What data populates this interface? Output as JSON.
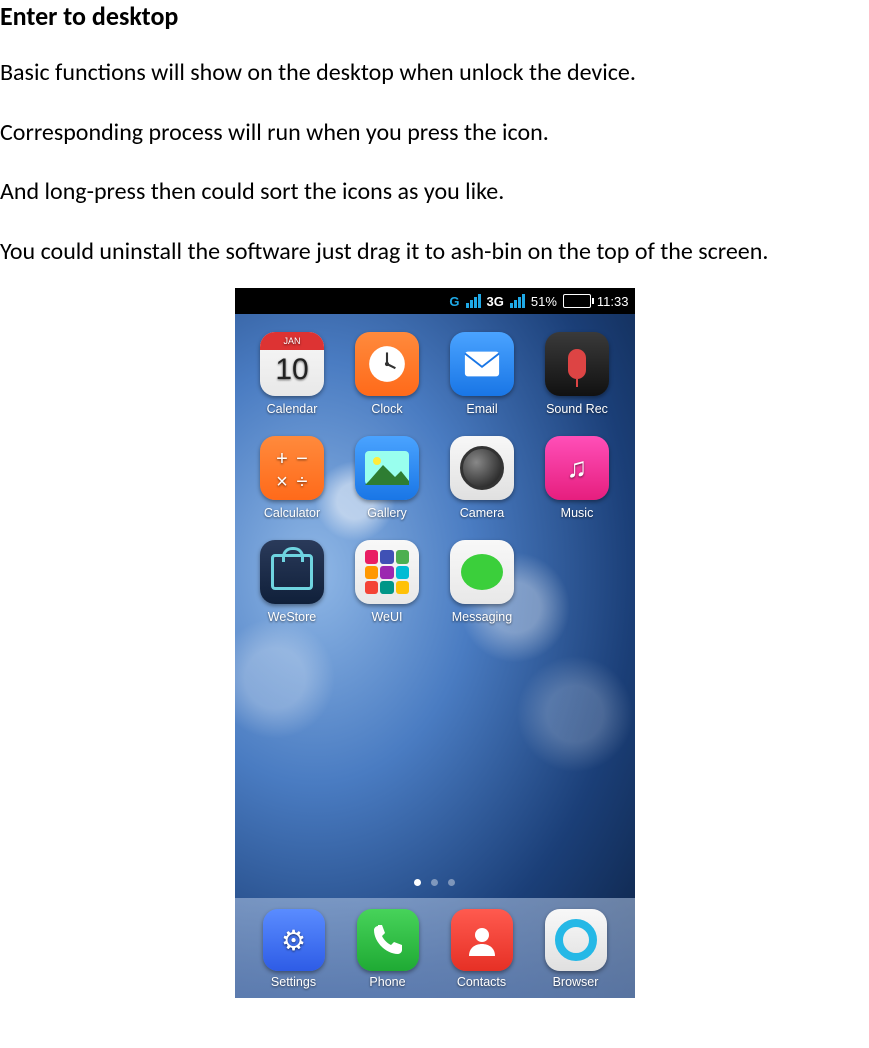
{
  "doc": {
    "heading": "Enter to desktop",
    "p1": "Basic functions will show on the desktop when unlock the device.",
    "p2": "Corresponding process will run when you press the icon.",
    "p3": "And long-press then could sort the icons as you like.",
    "p4": "You could uninstall the software just drag it to ash-bin on the top of the screen."
  },
  "status": {
    "g": "G",
    "tg": "3G",
    "battery_pct": "51%",
    "time": "11:33"
  },
  "calendar_icon": {
    "month": "JAN",
    "day": "10"
  },
  "apps": {
    "calendar": "Calendar",
    "clock": "Clock",
    "email": "Email",
    "sound": "Sound Rec",
    "calc": "Calculator",
    "gallery": "Gallery",
    "camera": "Camera",
    "music": "Music",
    "westore": "WeStore",
    "weui": "WeUI",
    "messaging": "Messaging"
  },
  "dock": {
    "settings": "Settings",
    "phone": "Phone",
    "contacts": "Contacts",
    "browser": "Browser"
  }
}
